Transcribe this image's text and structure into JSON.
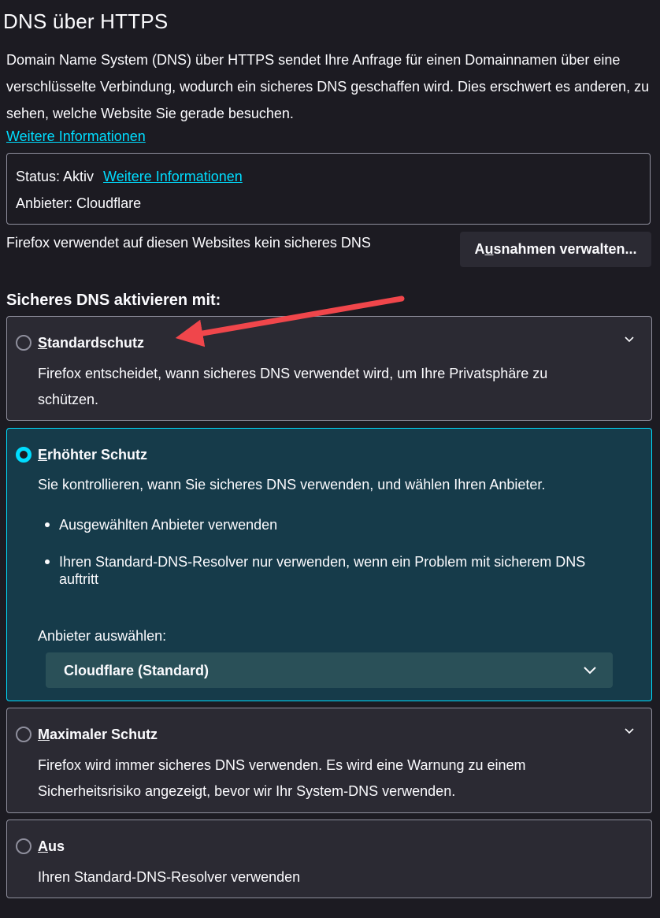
{
  "section": {
    "title": "DNS über HTTPS",
    "description": "Domain Name System (DNS) über HTTPS sendet Ihre Anfrage für einen Domainnamen über eine verschlüsselte Verbindung, wodurch ein sicheres DNS geschaffen wird. Dies erschwert es anderen, zu sehen, welche Website Sie gerade besuchen.",
    "learn_more": "Weitere Informationen"
  },
  "status_box": {
    "status": "Status: Aktiv",
    "learn_more": "Weitere Informationen",
    "provider": "Anbieter: Cloudflare"
  },
  "exceptions": {
    "text": "Firefox verwendet auf diesen Websites kein sicheres DNS",
    "button_pre": "A",
    "button_access": "u",
    "button_post": "snahmen verwalten..."
  },
  "enable_heading": "Sicheres DNS aktivieren mit:",
  "options": [
    {
      "access": "S",
      "rest": "tandardschutz",
      "description": "Firefox entscheidet, wann sicheres DNS verwendet wird, um Ihre Privatsphäre zu schützen.",
      "selected": false
    },
    {
      "access": "E",
      "rest": "rhöhter Schutz",
      "description": "Sie kontrollieren, wann Sie sicheres DNS verwenden, und wählen Ihren Anbieter.",
      "bullets": [
        "Ausgewählten Anbieter verwenden",
        "Ihren Standard-DNS-Resolver nur verwenden, wenn ein Problem mit sicherem DNS auftritt"
      ],
      "provider_label": "Anbieter auswählen:",
      "provider_value": "Cloudflare (Standard)",
      "selected": true
    },
    {
      "access": "M",
      "rest": "aximaler Schutz",
      "description": "Firefox wird immer sicheres DNS verwenden. Es wird eine Warnung zu einem Sicherheitsrisiko angezeigt, bevor wir Ihr System-DNS verwenden.",
      "selected": false
    },
    {
      "access": "A",
      "rest": "us",
      "description": "Ihren Standard-DNS-Resolver verwenden",
      "selected": false
    }
  ],
  "colors": {
    "background": "#1c1b22",
    "panel": "#2b2a33",
    "selected_panel": "#163b4a",
    "accent": "#00ddff",
    "annotation_arrow": "#f0464b"
  },
  "icons": {
    "expand": "chevron-down-icon",
    "annotation": "red-arrow-icon"
  }
}
